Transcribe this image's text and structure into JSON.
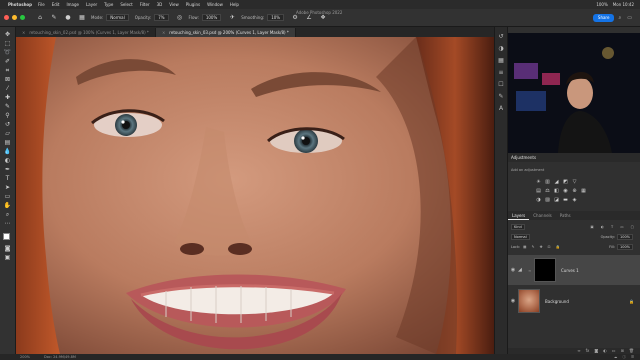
{
  "menubar": {
    "apple": "",
    "app_name": "Photoshop",
    "items": [
      "File",
      "Edit",
      "Image",
      "Layer",
      "Type",
      "Select",
      "Filter",
      "3D",
      "View",
      "Plugins",
      "Window",
      "Help"
    ],
    "right_items": [
      "100%",
      "Mon 10:42"
    ]
  },
  "window_title": "Adobe Photoshop 2022",
  "options_bar": {
    "mode_label": "Mode:",
    "mode_value": "Normal",
    "opacity_label": "Opacity:",
    "opacity_value": "7%",
    "flow_label": "Flow:",
    "flow_value": "100%",
    "smoothing_label": "Smoothing:",
    "smoothing_value": "10%",
    "share_label": "Share"
  },
  "tabs": [
    {
      "label": "retouching_skin_02.psd @ 100% (Curves 1, Layer Mask/8) *",
      "active": false
    },
    {
      "label": "retouching_skin_03.psd @ 200% (Curves 1, Layer Mask/8) *",
      "active": true
    }
  ],
  "status_bar": {
    "zoom": "200%",
    "doc_info": "Doc: 24.9M/49.8M"
  },
  "adjustments": {
    "header": "Adjustments",
    "subtitle": "Add an adjustment"
  },
  "layers_panel": {
    "tabs": [
      "Layers",
      "Channels",
      "Paths"
    ],
    "kind_label": "Kind",
    "blend_mode": "Normal",
    "opacity_label": "Opacity:",
    "opacity_value": "100%",
    "lock_label": "Lock:",
    "fill_label": "Fill:",
    "fill_value": "100%",
    "layers": [
      {
        "name": "Curves 1",
        "selected": true
      },
      {
        "name": "Background",
        "selected": false
      }
    ]
  },
  "colors": {
    "accent": "#1473e6",
    "panel": "#303030",
    "toolbar": "#323232"
  }
}
